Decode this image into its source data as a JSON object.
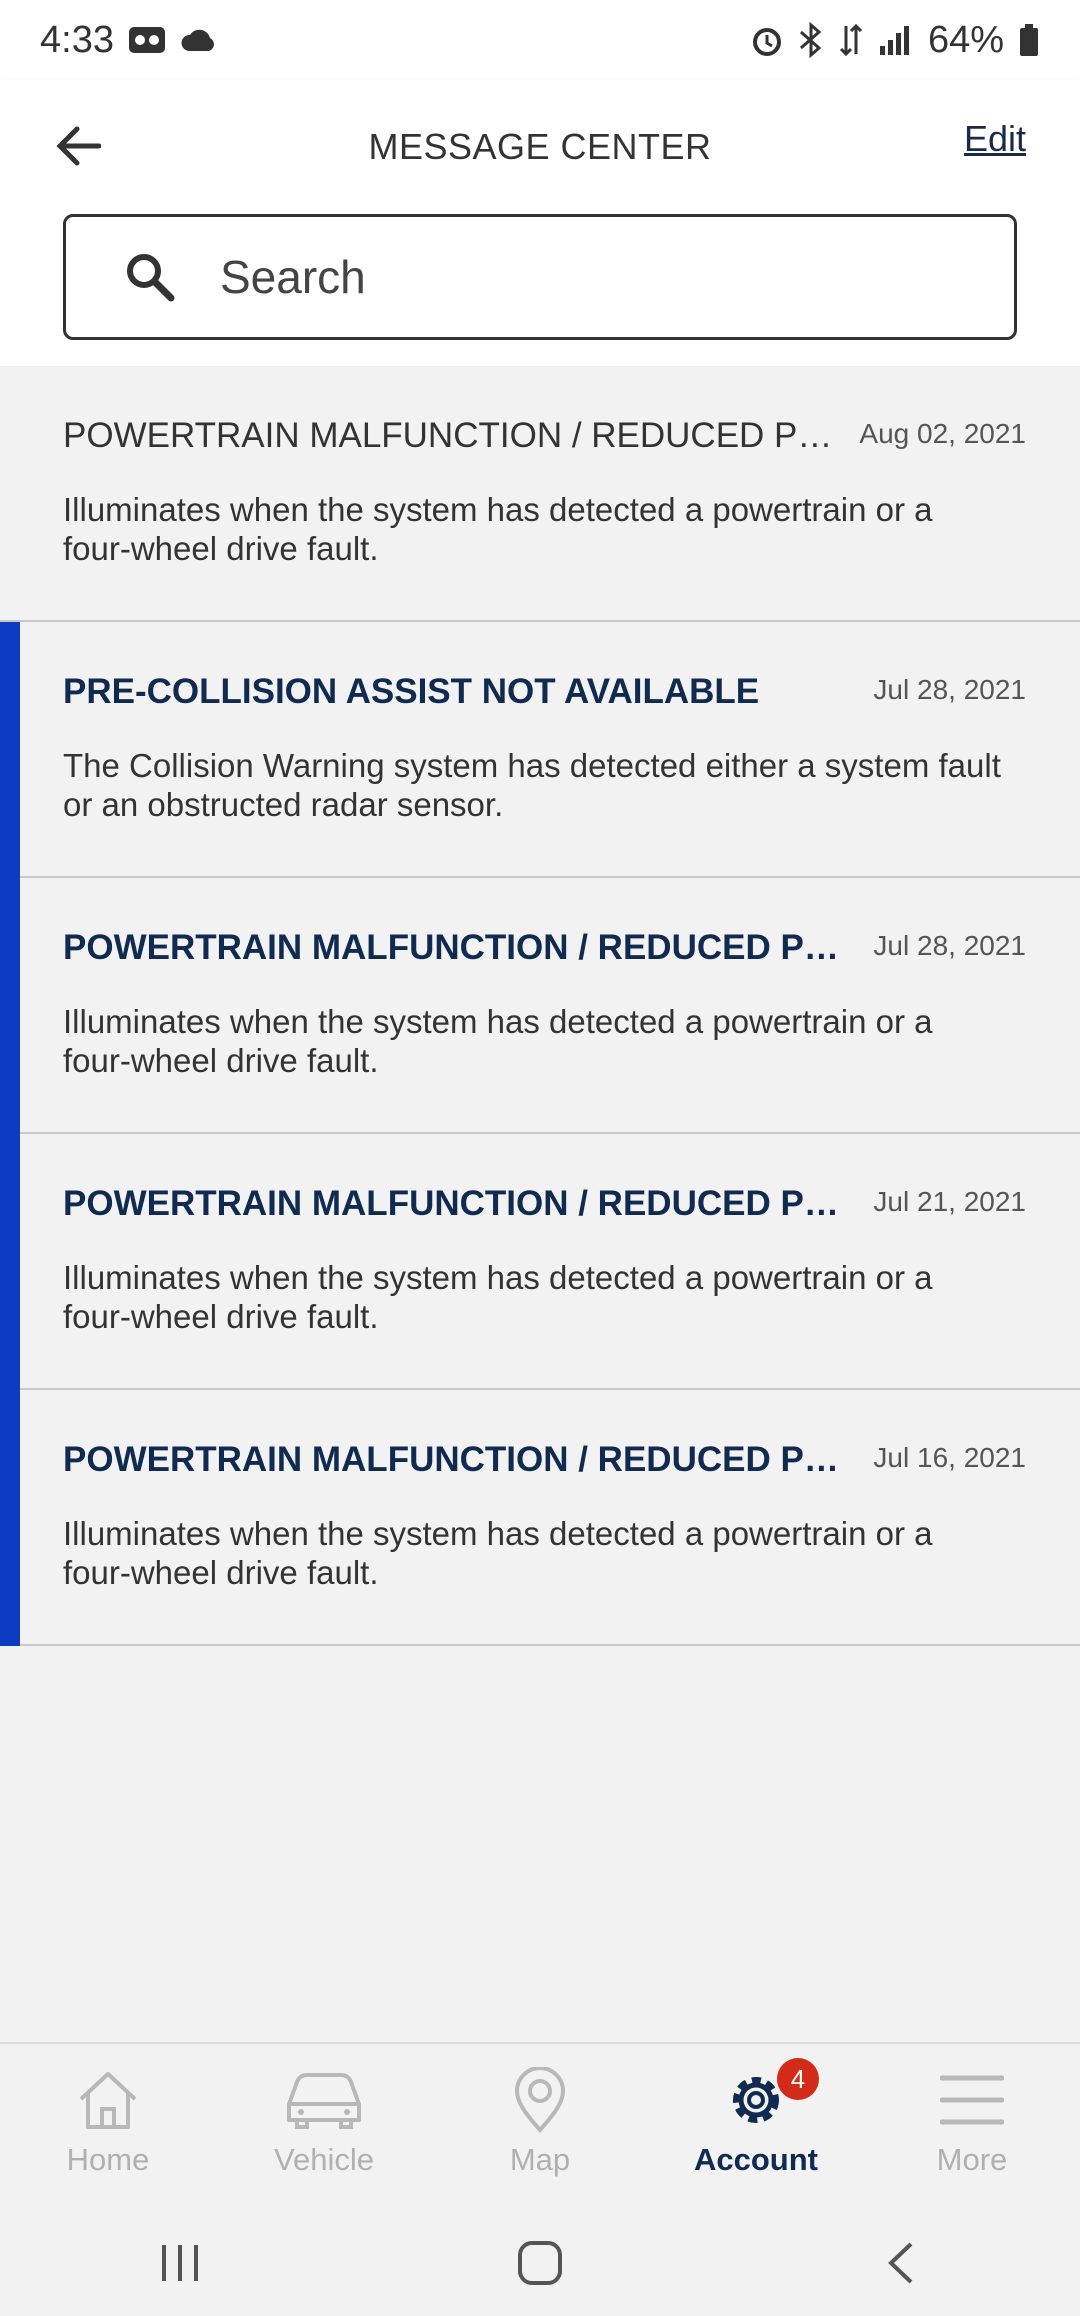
{
  "status_bar": {
    "time": "4:33",
    "battery": "64%"
  },
  "header": {
    "title": "MESSAGE CENTER",
    "edit_label": "Edit"
  },
  "search": {
    "placeholder": "Search",
    "value": ""
  },
  "messages": [
    {
      "title": "POWERTRAIN MALFUNCTION / REDUCED POWER",
      "date": "Aug 02, 2021",
      "body": "Illuminates when the system has detected a powertrain or a four-wheel drive fault.",
      "unread": false
    },
    {
      "title": "PRE-COLLISION ASSIST NOT AVAILABLE",
      "date": "Jul 28, 2021",
      "body": "The Collision Warning system has detected either a system fault or an obstructed radar sensor.",
      "unread": true
    },
    {
      "title": "POWERTRAIN MALFUNCTION / REDUCED POW...",
      "date": "Jul 28, 2021",
      "body": "Illuminates when the system has detected a powertrain or a four-wheel drive fault.",
      "unread": true
    },
    {
      "title": "POWERTRAIN MALFUNCTION / REDUCED POW...",
      "date": "Jul 21, 2021",
      "body": "Illuminates when the system has detected a powertrain or a four-wheel drive fault.",
      "unread": true
    },
    {
      "title": "POWERTRAIN MALFUNCTION / REDUCED POW...",
      "date": "Jul 16, 2021",
      "body": "Illuminates when the system has detected a powertrain or a four-wheel drive fault.",
      "unread": true
    }
  ],
  "bottom_nav": {
    "items": [
      {
        "label": "Home",
        "icon": "home-icon",
        "active": false
      },
      {
        "label": "Vehicle",
        "icon": "car-icon",
        "active": false
      },
      {
        "label": "Map",
        "icon": "map-pin-icon",
        "active": false
      },
      {
        "label": "Account",
        "icon": "gear-icon",
        "active": true,
        "badge": "4"
      },
      {
        "label": "More",
        "icon": "menu-icon",
        "active": false
      }
    ]
  },
  "colors": {
    "accent": "#0b3cc1",
    "unread_title": "#102a50",
    "badge": "#d42a1a"
  }
}
